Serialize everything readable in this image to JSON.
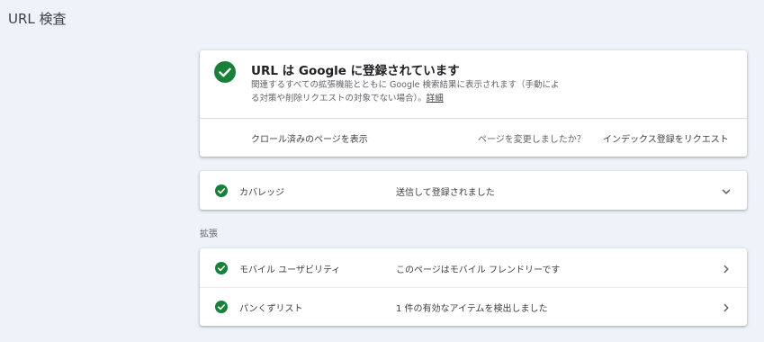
{
  "header": {
    "title": "URL 検査"
  },
  "status": {
    "icon": "check-circle-icon",
    "title": "URL は Google に登録されています",
    "description_line1": "関連するすべての拡張機能とともに Google 検索結果に表示されます（手動によ",
    "description_line2": "る対策や削除リクエストの対象でない場合）。",
    "details_link": "詳細",
    "actions": {
      "view_crawled": "クロール済みのページを表示",
      "page_changed": "ページを変更しましたか？",
      "request_indexing": "インデックス登録をリクエスト"
    }
  },
  "coverage": {
    "label": "カバレッジ",
    "value": "送信して登録されました",
    "expand_icon": "chevron-down-icon"
  },
  "enhancements": {
    "section_label": "拡張",
    "items": [
      {
        "label": "モバイル ユーザビリティ",
        "value": "このページはモバイル フレンドリーです",
        "icon": "chevron-right-icon"
      },
      {
        "label": "パンくずリスト",
        "value": "1 件の有効なアイテムを検出しました",
        "icon": "chevron-right-icon"
      }
    ]
  },
  "colors": {
    "success": "#188038",
    "background": "#eef2f9"
  }
}
